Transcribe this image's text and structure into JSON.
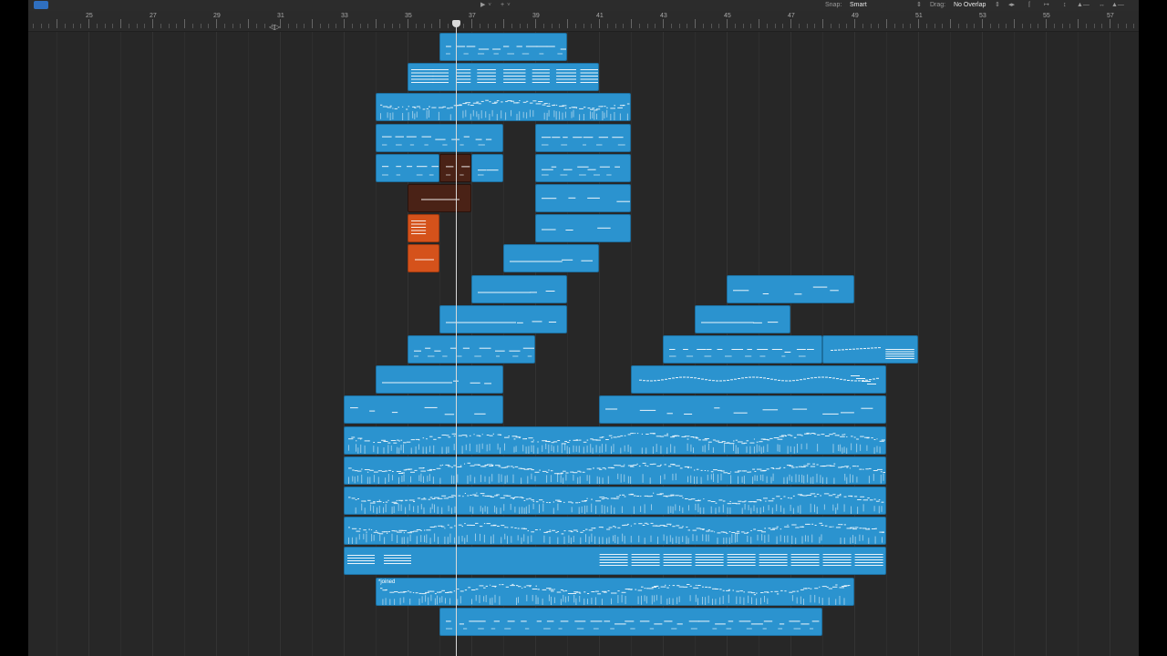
{
  "toolbar": {
    "snap_label": "Snap:",
    "snap_value": "Smart",
    "drag_label": "Drag:",
    "drag_value": "No Overlap"
  },
  "ruler": {
    "bars": [
      {
        "n": "25",
        "b": 25
      },
      {
        "n": "27",
        "b": 27
      },
      {
        "n": "29",
        "b": 29
      },
      {
        "n": "31",
        "b": 31
      },
      {
        "n": "33",
        "b": 33
      },
      {
        "n": "35",
        "b": 35
      },
      {
        "n": "37",
        "b": 37
      },
      {
        "n": "39",
        "b": 39
      },
      {
        "n": "41",
        "b": 41
      },
      {
        "n": "43",
        "b": 43
      },
      {
        "n": "45",
        "b": 45
      },
      {
        "n": "47",
        "b": 47
      },
      {
        "n": "49",
        "b": 49
      },
      {
        "n": "51",
        "b": 51
      },
      {
        "n": "53",
        "b": 53
      },
      {
        "n": "55",
        "b": 55
      },
      {
        "n": "57",
        "b": 57
      }
    ]
  },
  "playhead_bar": 36.5,
  "colors": {
    "region_blue": "#2b93cf",
    "region_dark_red": "#4a2216",
    "region_orange": "#d5521b",
    "note_white": "#ffffff"
  },
  "regions": [
    {
      "track": 0,
      "start": 36,
      "end": 40,
      "color": "blue",
      "pattern": "dashes"
    },
    {
      "track": 1,
      "start": 35,
      "end": 41,
      "color": "blue",
      "pattern": "chords"
    },
    {
      "track": 2,
      "start": 34,
      "end": 42,
      "color": "blue",
      "pattern": "dense"
    },
    {
      "track": 3,
      "start": 34,
      "end": 38,
      "color": "blue",
      "pattern": "dashes"
    },
    {
      "track": 3,
      "start": 39,
      "end": 42,
      "color": "blue",
      "pattern": "dashes"
    },
    {
      "track": 4,
      "start": 34,
      "end": 36,
      "color": "blue",
      "pattern": "dashes"
    },
    {
      "track": 4,
      "start": 36,
      "end": 37,
      "color": "darkred",
      "pattern": "dashes"
    },
    {
      "track": 4,
      "start": 37,
      "end": 38,
      "color": "blue",
      "pattern": "dashes"
    },
    {
      "track": 4,
      "start": 39,
      "end": 42,
      "color": "blue",
      "pattern": "dashes"
    },
    {
      "track": 5,
      "start": 35,
      "end": 37,
      "color": "darkred",
      "pattern": "single"
    },
    {
      "track": 5,
      "start": 39,
      "end": 42,
      "color": "blue",
      "pattern": "sparse"
    },
    {
      "track": 6,
      "start": 35,
      "end": 36,
      "color": "orange",
      "pattern": "chords"
    },
    {
      "track": 6,
      "start": 39,
      "end": 42,
      "color": "blue",
      "pattern": "sparse"
    },
    {
      "track": 7,
      "start": 35,
      "end": 36,
      "color": "orange",
      "pattern": "single"
    },
    {
      "track": 7,
      "start": 38,
      "end": 41,
      "color": "blue",
      "pattern": "long"
    },
    {
      "track": 8,
      "start": 37,
      "end": 40,
      "color": "blue",
      "pattern": "long"
    },
    {
      "track": 8,
      "start": 45,
      "end": 49,
      "color": "blue",
      "pattern": "sparse"
    },
    {
      "track": 9,
      "start": 36,
      "end": 40,
      "color": "blue",
      "pattern": "long"
    },
    {
      "track": 9,
      "start": 44,
      "end": 47,
      "color": "blue",
      "pattern": "long"
    },
    {
      "track": 10,
      "start": 35,
      "end": 39,
      "color": "blue",
      "pattern": "dashes"
    },
    {
      "track": 10,
      "start": 43,
      "end": 48,
      "color": "blue",
      "pattern": "dashes"
    },
    {
      "track": 10,
      "start": 48,
      "end": 51,
      "color": "blue",
      "pattern": "rise"
    },
    {
      "track": 11,
      "start": 34,
      "end": 38,
      "color": "blue",
      "pattern": "long"
    },
    {
      "track": 11,
      "start": 42,
      "end": 50,
      "color": "blue",
      "pattern": "wave"
    },
    {
      "track": 12,
      "start": 33,
      "end": 38,
      "color": "blue",
      "pattern": "sparse"
    },
    {
      "track": 12,
      "start": 41,
      "end": 50,
      "color": "blue",
      "pattern": "sparse"
    },
    {
      "track": 13,
      "start": 33,
      "end": 50,
      "color": "blue",
      "pattern": "dense"
    },
    {
      "track": 14,
      "start": 33,
      "end": 50,
      "color": "blue",
      "pattern": "dense"
    },
    {
      "track": 15,
      "start": 33,
      "end": 50,
      "color": "blue",
      "pattern": "dense"
    },
    {
      "track": 16,
      "start": 33,
      "end": 50,
      "color": "blue",
      "pattern": "dense"
    },
    {
      "track": 17,
      "start": 33,
      "end": 50,
      "color": "blue",
      "pattern": "chordrow"
    },
    {
      "track": 18,
      "start": 34,
      "end": 49,
      "color": "blue",
      "pattern": "dense",
      "name": "*joined"
    },
    {
      "track": 19,
      "start": 36,
      "end": 48,
      "color": "blue",
      "pattern": "dashes"
    }
  ]
}
